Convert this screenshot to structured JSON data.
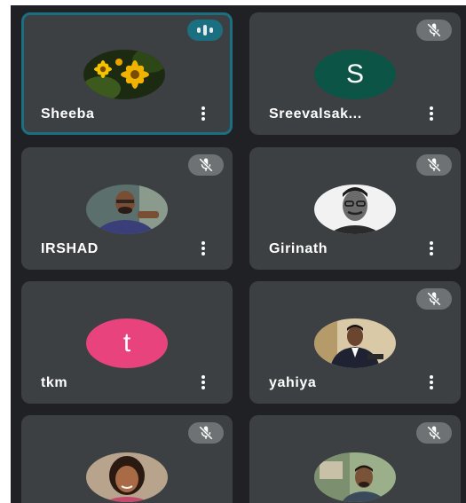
{
  "participants": [
    {
      "name": "Sheeba",
      "status": "speaking",
      "avatar": "photo-yellow-flowers",
      "speaking_color": "#1a6f80"
    },
    {
      "name": "Sreevalsak...",
      "status": "muted",
      "avatar": "initial",
      "initial": "S",
      "avatar_color": "#0b5446"
    },
    {
      "name": "IRSHAD",
      "status": "muted",
      "avatar": "photo-man-glasses"
    },
    {
      "name": "Girinath",
      "status": "muted",
      "avatar": "photo-man-bw"
    },
    {
      "name": "tkm",
      "status": "unmuted",
      "avatar": "initial",
      "initial": "t",
      "avatar_color": "#e8437c"
    },
    {
      "name": "yahiya",
      "status": "muted",
      "avatar": "photo-man-suit"
    },
    {
      "name": "",
      "status": "muted",
      "avatar": "photo-woman"
    },
    {
      "name": "",
      "status": "muted",
      "avatar": "photo-man-outdoor"
    }
  ],
  "icons": {
    "mute": "mic-off-icon",
    "more": "more-vert-icon",
    "speaking": "audio-level-icon"
  },
  "colors": {
    "background": "#202124",
    "tile": "#3c4043",
    "active_border": "#1a6f80",
    "mute_badge": "#6e7275"
  }
}
